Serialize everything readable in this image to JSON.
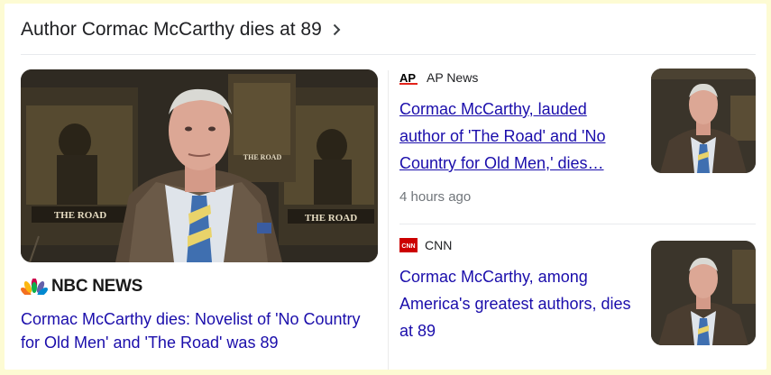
{
  "header": {
    "title": "Author Cormac McCarthy dies at 89",
    "icon": "chevron-right-icon"
  },
  "main_story": {
    "source": "NBC NEWS",
    "source_logo": "peacock-logo",
    "headline": "Cormac McCarthy dies: Novelist of 'No Country for Old Men' and 'The Road' was 89",
    "image_posters": {
      "left": "THE ROAD",
      "right": "THE ROAD",
      "top_right": "THE ROAD"
    }
  },
  "side_stories": [
    {
      "source_badge": "AP",
      "source": "AP News",
      "headline": "Cormac McCarthy, lauded author of 'The Road' and 'No Country for Old Men,' dies…",
      "time": "4 hours ago"
    },
    {
      "source_badge": "CNN",
      "source": "CNN",
      "headline": "Cormac McCarthy, among America's greatest authors, dies at 89",
      "time": ""
    }
  ],
  "colors": {
    "link": "#1a0dab",
    "ap_red": "#e2231a",
    "cnn_red": "#cc0000",
    "page_bg": "#fdfbd3"
  }
}
